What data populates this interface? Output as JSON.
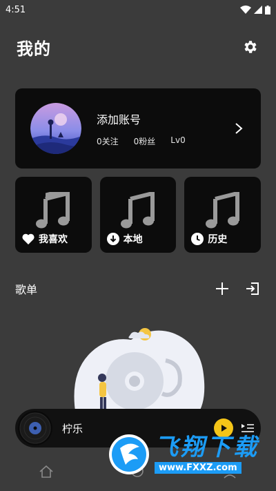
{
  "status_bar": {
    "time": "4:51"
  },
  "header": {
    "title": "我的"
  },
  "account": {
    "name": "添加账号",
    "following": "0关注",
    "fans": "0粉丝",
    "level": "Lv0"
  },
  "tiles": [
    {
      "label": "我喜欢",
      "icon": "heart-icon"
    },
    {
      "label": "本地",
      "icon": "download-icon"
    },
    {
      "label": "历史",
      "icon": "clock-icon"
    }
  ],
  "playlists": {
    "title": "歌单"
  },
  "player": {
    "track": "柠乐"
  },
  "watermark": {
    "brand": "飞翔下载",
    "url": "www.FXXZ.com"
  },
  "colors": {
    "background": "#3b3b3b",
    "card": "#0c0c0c",
    "accent": "#f5c518",
    "watermark": "#1c9cf6"
  }
}
